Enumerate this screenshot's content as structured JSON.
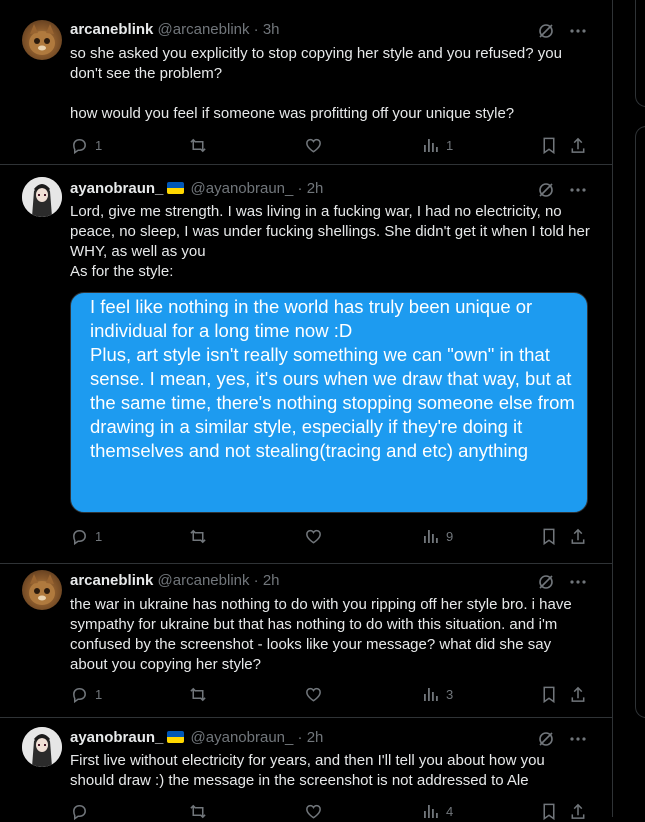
{
  "tweets": [
    {
      "name": "arcaneblink",
      "handle": "@arcaneblink",
      "time": "· 3h",
      "avatar_icon": "cat-avatar",
      "text_lines": [
        "so she asked you explicitly to stop copying her style and you refused? you don't see the problem?",
        "how would you feel if someone was profitting off your unique style?"
      ],
      "replies": "1",
      "views": "1"
    },
    {
      "name": "ayanobraun_",
      "flag_colors": [
        "#0057b7",
        "#ffd700"
      ],
      "handle": "@ayanobraun_",
      "time": "· 2h",
      "avatar_icon": "anime-girl-avatar",
      "text_lines": [
        "Lord, give me strength. I was living in a fucking war, I had no electricity, no peace, no sleep, I was under fucking shellings. She didn't get it when I told her WHY, as well as you",
        "As for the style:"
      ],
      "image_text": [
        "I feel like nothing in the world has truly been unique or individual for a long time now :D",
        "Plus, art style isn't really something we can \"own\" in that sense. I mean, yes, it's ours when we draw that way, but at the same time, there's nothing stopping someone else from drawing in a similar style, especially if they're doing it themselves and not stealing(tracing and etc) anything"
      ],
      "replies": "1",
      "views": "9"
    },
    {
      "name": "arcaneblink",
      "handle": "@arcaneblink",
      "time": "· 2h",
      "avatar_icon": "cat-avatar",
      "text_lines": [
        "the war in ukraine has nothing to do with you ripping off her style bro. i have sympathy for ukraine but that has nothing to do with this situation. and i'm confused by the screenshot - looks like your message? what did she say about you copying her style?"
      ],
      "replies": "1",
      "views": "3"
    },
    {
      "name": "ayanobraun_",
      "flag_colors": [
        "#0057b7",
        "#ffd700"
      ],
      "handle": "@ayanobraun_",
      "time": "· 2h",
      "avatar_icon": "anime-girl-avatar",
      "text_lines": [
        "First live without electricity for years, and then I'll tell you about how you should draw :) the message in the screenshot is not addressed to Ale"
      ],
      "replies": "",
      "views": "4"
    }
  ],
  "colors": {
    "background": "#000000",
    "text": "#e7e9ea",
    "muted": "#71767b",
    "border": "#2f3336",
    "bubble": "#1d9bf0"
  }
}
